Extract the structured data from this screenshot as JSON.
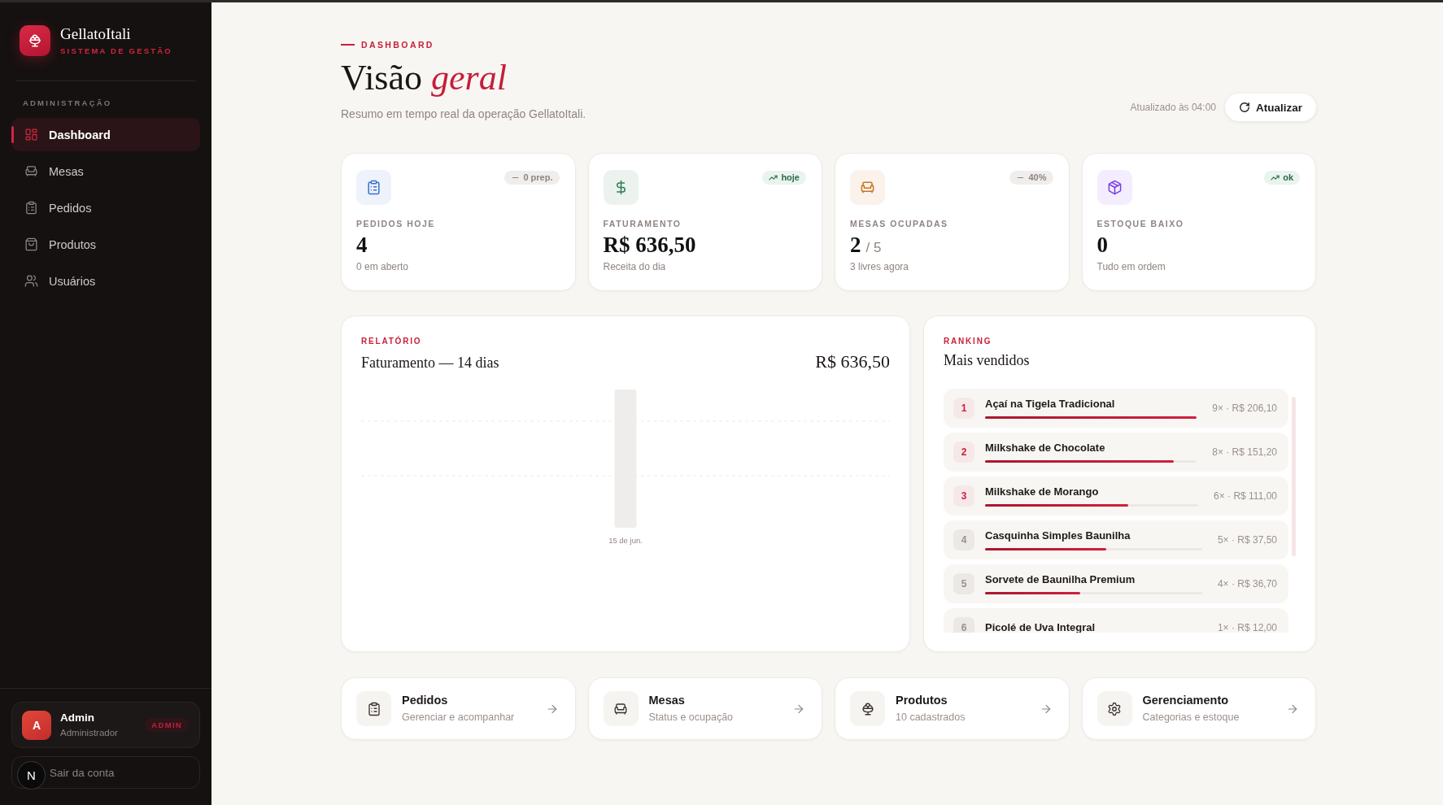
{
  "sidebar": {
    "brand": {
      "name": "GellatoItali",
      "tagline": "SISTEMA DE GESTÃO"
    },
    "section_label": "ADMINISTRAÇÃO",
    "items": [
      {
        "label": "Dashboard",
        "selected": true
      },
      {
        "label": "Mesas",
        "selected": false
      },
      {
        "label": "Pedidos",
        "selected": false
      },
      {
        "label": "Produtos",
        "selected": false
      },
      {
        "label": "Usuários",
        "selected": false
      }
    ],
    "user": {
      "initial": "A",
      "name": "Admin",
      "role": "Administrador",
      "tag": "ADMIN"
    },
    "logout": {
      "label": "Sair da conta"
    }
  },
  "dev_button": {
    "label": "N"
  },
  "header": {
    "eyebrow": "DASHBOARD",
    "title": "Visão *geral*",
    "subtitle": "Resumo em tempo real da operação GellatoItali.",
    "updated": "Atualizado às 04:00",
    "refresh_button": "Atualizar"
  },
  "stats": [
    {
      "label": "PEDIDOS HOJE",
      "value": "4",
      "subtitle": "0 em aberto",
      "color": "#3b6fd0",
      "badge": {
        "kind": "flat",
        "text": "0 prep."
      }
    },
    {
      "label": "FATURAMENTO",
      "value": "R$ 636,50",
      "subtitle": "Receita do dia",
      "color": "#2e7d52",
      "badge": {
        "kind": "up",
        "text": "hoje"
      }
    },
    {
      "label": "MESAS OCUPADAS",
      "value": "2",
      "value_suffix": "/ 5",
      "subtitle": "3 livres agora",
      "color": "#c9741f",
      "badge": {
        "kind": "flat",
        "text": "40%"
      }
    },
    {
      "label": "ESTOQUE BAIXO",
      "value": "0",
      "subtitle": "Tudo em ordem",
      "color": "#7c3aed",
      "badge": {
        "kind": "up",
        "text": "ok"
      }
    }
  ],
  "revenue": {
    "eyebrow": "RELATÓRIO",
    "title": "Faturamento — 14 dias",
    "total": "R$ 636,50",
    "x_labels": [
      "15 de jun."
    ]
  },
  "ranking": {
    "eyebrow": "RANKING",
    "title": "Mais vendidos",
    "items": [
      {
        "rank": "1",
        "name": "Açaí na Tigela Tradicional",
        "summary": "9× · R$ 206,10",
        "level": 1,
        "highlighted": true
      },
      {
        "rank": "2",
        "name": "Milkshake de Chocolate",
        "summary": "8× · R$ 151,20",
        "level": 0.89,
        "highlighted": true
      },
      {
        "rank": "3",
        "name": "Milkshake de Morango",
        "summary": "6× · R$ 111,00",
        "level": 0.67,
        "highlighted": true
      },
      {
        "rank": "4",
        "name": "Casquinha Simples Baunilha",
        "summary": "5× · R$ 37,50",
        "level": 0.56,
        "highlighted": false
      },
      {
        "rank": "5",
        "name": "Sorvete de Baunilha Premium",
        "summary": "4× · R$ 36,70",
        "level": 0.44,
        "highlighted": false
      },
      {
        "rank": "6",
        "name": "Picolé de Uva Integral",
        "summary": "1× · R$ 12,00",
        "highlighted": false
      }
    ]
  },
  "shortcuts": [
    {
      "title": "Pedidos",
      "subtitle": "Gerenciar e acompanhar"
    },
    {
      "title": "Mesas",
      "subtitle": "Status e ocupação"
    },
    {
      "title": "Produtos",
      "subtitle": "10 cadastrados"
    },
    {
      "title": "Gerenciamento",
      "subtitle": "Categorias e estoque"
    }
  ]
}
